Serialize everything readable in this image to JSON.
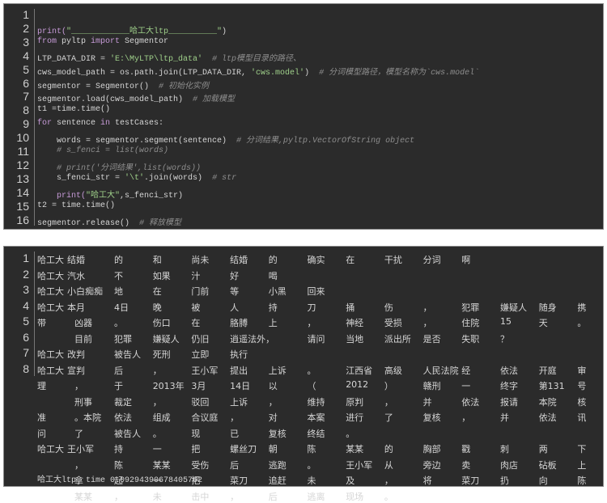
{
  "code": {
    "line_numbers": [
      "1",
      "2",
      "3",
      "4",
      "5",
      "6",
      "7",
      "8",
      "9",
      "10",
      "11",
      "12",
      "13",
      "14",
      "15",
      "16"
    ],
    "lines": [
      [],
      [
        {
          "t": "print(",
          "c": "kw"
        },
        {
          "t": "\"____________哈工大ltp__________\"",
          "c": "str"
        },
        {
          "t": ")",
          "c": "plain"
        }
      ],
      [
        {
          "t": "from",
          "c": "kw"
        },
        {
          "t": " pyltp ",
          "c": "plain"
        },
        {
          "t": "import",
          "c": "kw"
        },
        {
          "t": " Segmentor",
          "c": "plain"
        }
      ],
      [
        {
          "t": "LTP_DATA_DIR = ",
          "c": "plain"
        },
        {
          "t": "'E:\\MyLTP\\ltp_data'",
          "c": "str"
        },
        {
          "t": "  # ltp模型目录的路径、",
          "c": "cmt"
        }
      ],
      [
        {
          "t": "cws_model_path = os.path.join(LTP_DATA_DIR, ",
          "c": "plain"
        },
        {
          "t": "'cws.model'",
          "c": "str"
        },
        {
          "t": ")  ",
          "c": "plain"
        },
        {
          "t": "# 分词模型路径，模型名称为`cws.model`",
          "c": "cmt"
        }
      ],
      [
        {
          "t": "segmentor = Segmentor()  ",
          "c": "plain"
        },
        {
          "t": "# 初始化实例",
          "c": "cmt"
        }
      ],
      [
        {
          "t": "segmentor.load(cws_model_path)  ",
          "c": "plain"
        },
        {
          "t": "# 加载模型",
          "c": "cmt"
        }
      ],
      [
        {
          "t": "t1 =time.time()",
          "c": "plain"
        }
      ],
      [
        {
          "t": "for",
          "c": "kw"
        },
        {
          "t": " sentence ",
          "c": "plain"
        },
        {
          "t": "in",
          "c": "kw"
        },
        {
          "t": " testCases:",
          "c": "plain"
        }
      ],
      [
        {
          "t": "    words = segmentor.segment(sentence)  ",
          "c": "plain"
        },
        {
          "t": "# 分词结果,pyltp.VectorOfString object",
          "c": "cmt"
        }
      ],
      [
        {
          "t": "    # s_fenci = list(words)",
          "c": "cmt"
        }
      ],
      [
        {
          "t": "    # print('分词结果',list(words))",
          "c": "cmt"
        }
      ],
      [
        {
          "t": "    s_fenci_str = ",
          "c": "plain"
        },
        {
          "t": "'\\t'",
          "c": "str"
        },
        {
          "t": ".join(words)  ",
          "c": "plain"
        },
        {
          "t": "# str",
          "c": "cmt"
        }
      ],
      [
        {
          "t": "    print(",
          "c": "kw"
        },
        {
          "t": "\"哈工大\"",
          "c": "str"
        },
        {
          "t": ",s_fenci_str)",
          "c": "plain"
        }
      ],
      [
        {
          "t": "t2 = time.time()",
          "c": "plain"
        }
      ],
      [
        {
          "t": "segmentor.release()  ",
          "c": "plain"
        },
        {
          "t": "# 释放模型",
          "c": "cmt"
        }
      ]
    ]
  },
  "output": {
    "line_numbers": [
      "1",
      "2",
      "3",
      "4",
      "5",
      "6",
      "7",
      "8"
    ],
    "rows": [
      [
        "哈工大",
        "结婚",
        "的",
        "和",
        "尚未",
        "结婚",
        "的",
        "确实",
        "在",
        "干扰",
        "分词",
        "啊",
        "",
        "",
        ""
      ],
      [
        "哈工大",
        "汽水",
        "不",
        "如果",
        "汁",
        "好",
        "喝",
        "",
        "",
        "",
        "",
        "",
        "",
        "",
        ""
      ],
      [
        "哈工大",
        "小白痴痴",
        "地",
        "在",
        "门前",
        "等",
        "小黑",
        "回来",
        "",
        "",
        "",
        "",
        "",
        "",
        ""
      ],
      [
        "哈工大",
        "本月",
        "4日",
        "晚",
        "被",
        "人",
        "持",
        "刀",
        "捅",
        "伤",
        "，",
        "犯罪",
        "嫌疑人",
        "随身",
        "携"
      ],
      [
        "带",
        "凶器",
        "。",
        "伤口",
        "在",
        "胳膊",
        "上",
        "，",
        "神经",
        "受损",
        "，",
        "住院",
        "15",
        "天",
        "。"
      ],
      [
        "",
        "目前",
        "犯罪",
        "嫌疑人",
        "仍旧",
        "逍遥法外，",
        "",
        "请问",
        "当地",
        "派出所",
        "是否",
        "失职",
        "？",
        "",
        ""
      ],
      [
        "哈工大",
        "改判",
        "被告人",
        "死刑",
        "立即",
        "执行",
        "",
        "",
        "",
        "",
        "",
        "",
        "",
        "",
        ""
      ],
      [
        "哈工大",
        "宣判",
        "后",
        "，",
        "王小军",
        "提出",
        "上诉",
        "。",
        "江西省",
        "高级",
        "人民法院",
        "经",
        "依法",
        "开庭",
        "审"
      ],
      [
        "理",
        "，",
        "于",
        "2013年",
        "3月",
        "14日",
        "以",
        "（",
        "2012",
        "）",
        "赣刑",
        "一",
        "终字",
        "第131",
        "号"
      ],
      [
        "",
        "刑事",
        "裁定",
        "，",
        "驳回",
        "上诉",
        "，",
        "维持",
        "原判",
        "，",
        "并",
        "依法",
        "报请",
        "本院",
        "核"
      ],
      [
        "准",
        "。本院",
        "依法",
        "组成",
        "合议庭",
        "，",
        "对",
        "本案",
        "进行",
        "了",
        "复核",
        "，",
        "并",
        "依法",
        "讯"
      ],
      [
        "问",
        "了",
        "被告人",
        "。",
        "现",
        "已",
        "复核",
        "终结",
        "。",
        "",
        "",
        "",
        "",
        "",
        ""
      ],
      [
        "哈工大",
        "王小军",
        "持",
        "一",
        "把",
        "螺丝刀",
        "朝",
        "陈",
        "某某",
        "的",
        "胸部",
        "戳",
        "刺",
        "两",
        "下"
      ],
      [
        "",
        "，",
        "陈",
        "某某",
        "受伤",
        "后",
        "逃跑",
        "。",
        "王小军",
        "从",
        "旁边",
        "卖",
        "肉店",
        "砧板",
        "上"
      ],
      [
        "",
        "拿",
        "起",
        "一",
        "把",
        "菜刀",
        "追赶",
        "未",
        "及",
        "，",
        "将",
        "菜刀",
        "扔",
        "向",
        "陈"
      ],
      [
        "",
        "某某",
        "，",
        "未",
        "击中",
        "，",
        "后",
        "逃离",
        "现场",
        "。",
        "",
        "",
        "",
        "",
        ""
      ]
    ],
    "time_line": "哈工大ltp  time 0.09294390678405762"
  }
}
